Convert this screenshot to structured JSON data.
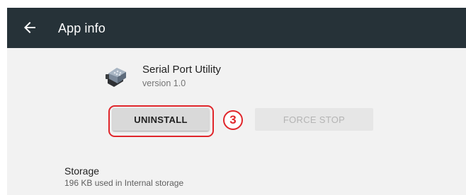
{
  "toolbar": {
    "title": "App info",
    "background": "#263238"
  },
  "app": {
    "name": "Serial Port Utility",
    "version": "version 1.0",
    "icon": "serial-port-connector-icon"
  },
  "actions": {
    "uninstall_label": "UNINSTALL",
    "force_stop_label": "FORCE STOP"
  },
  "annotation": {
    "step": "3",
    "color": "#e0262b"
  },
  "storage": {
    "title": "Storage",
    "detail": "196 KB used in Internal storage"
  }
}
